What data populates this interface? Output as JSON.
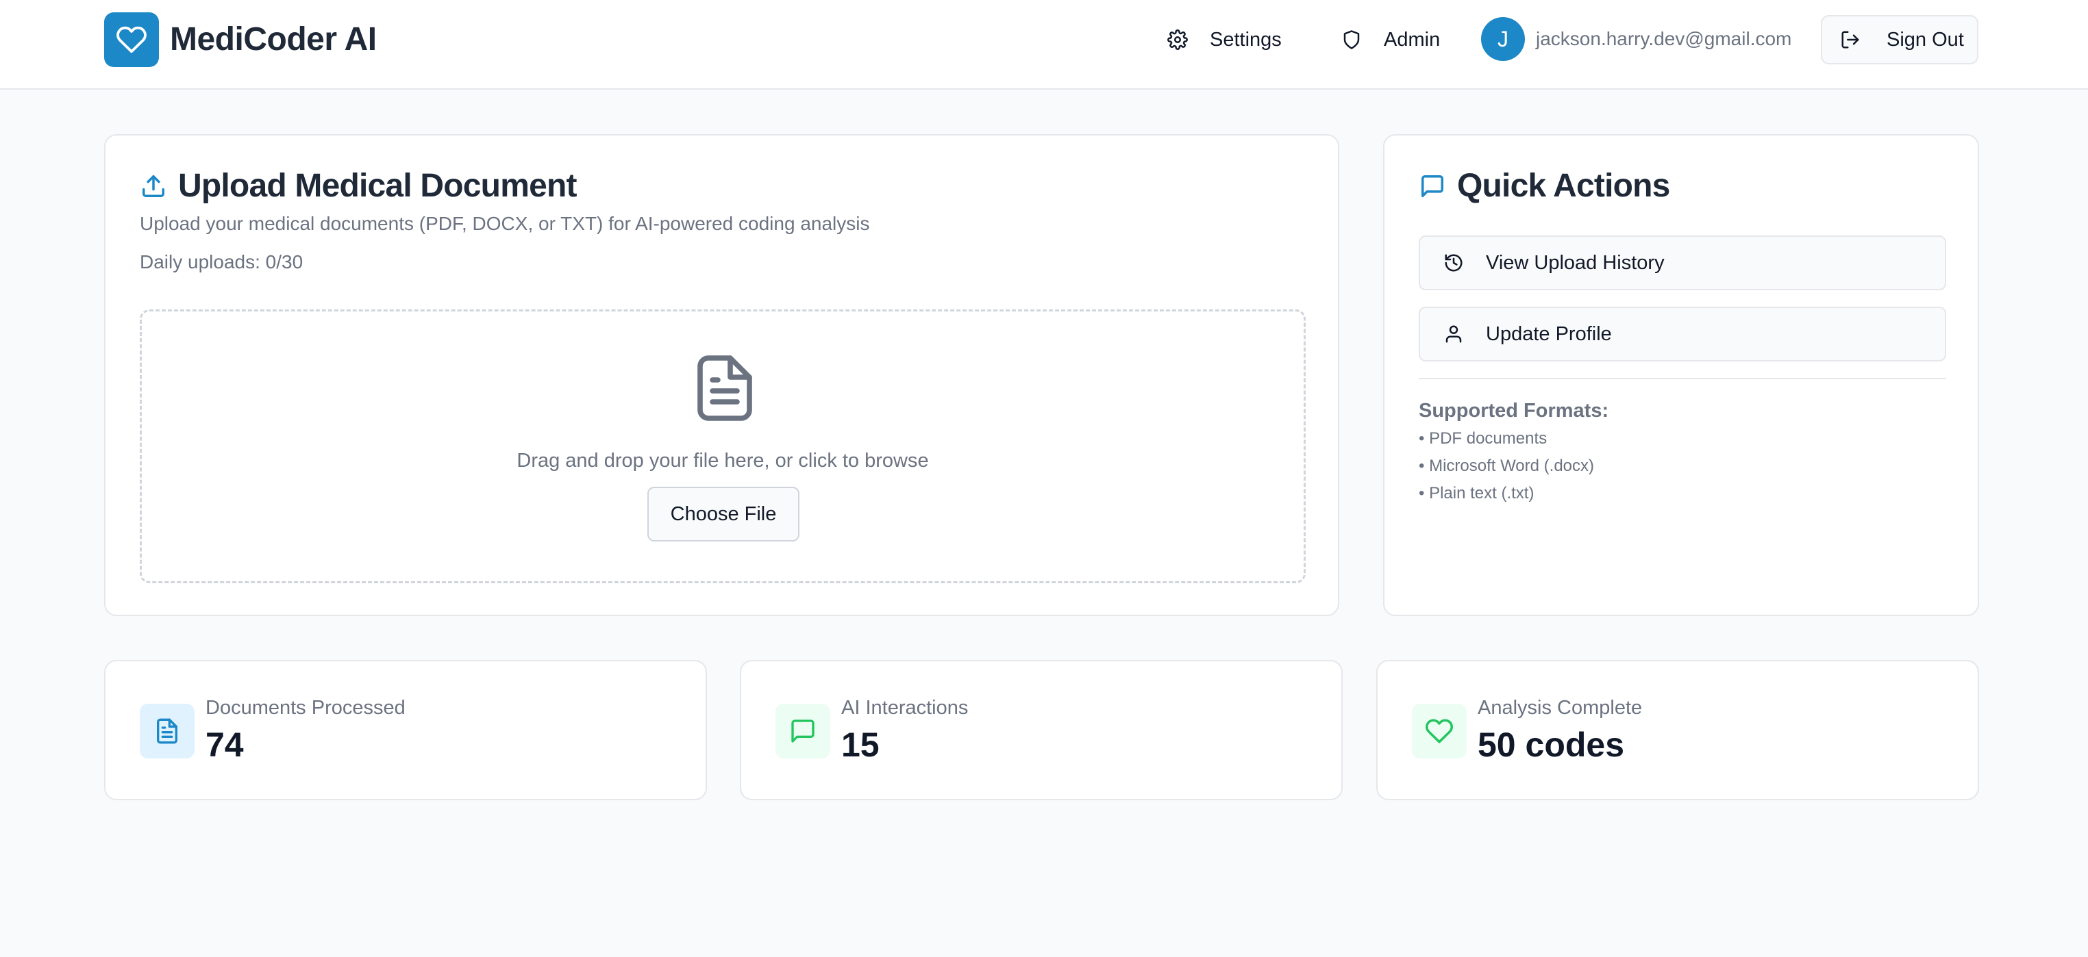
{
  "colors": {
    "brand": "#1c88c7",
    "text_muted": "#6b7280",
    "green_accent": "#22c55e",
    "blue_tint_bg": "#e0f2fe",
    "green_tint_bg": "#ecfdf3"
  },
  "header": {
    "app_title": "MediCoder AI",
    "logo_icon": "heart-icon",
    "nav": {
      "settings_label": "Settings",
      "admin_label": "Admin"
    },
    "user": {
      "avatar_initial": "J",
      "email": "jackson.harry.dev@gmail.com"
    },
    "sign_out_label": "Sign Out"
  },
  "upload": {
    "title": "Upload Medical Document",
    "description": "Upload your medical documents (PDF, DOCX, or TXT) for AI-powered coding analysis",
    "daily_uploads": "Daily uploads: 0/30",
    "dropzone_text": "Drag and drop your file here, or click to browse",
    "choose_file_label": "Choose File"
  },
  "quick_actions": {
    "title": "Quick Actions",
    "view_history_label": "View Upload History",
    "update_profile_label": "Update Profile",
    "formats_title": "Supported Formats:",
    "formats": [
      "• PDF documents",
      "• Microsoft Word (.docx)",
      "• Plain text (.txt)"
    ]
  },
  "stats": [
    {
      "label": "Documents Processed",
      "value": "74",
      "icon": "document-icon"
    },
    {
      "label": "AI Interactions",
      "value": "15",
      "icon": "message-icon"
    },
    {
      "label": "Analysis Complete",
      "value": "50 codes",
      "icon": "heart-icon"
    }
  ]
}
